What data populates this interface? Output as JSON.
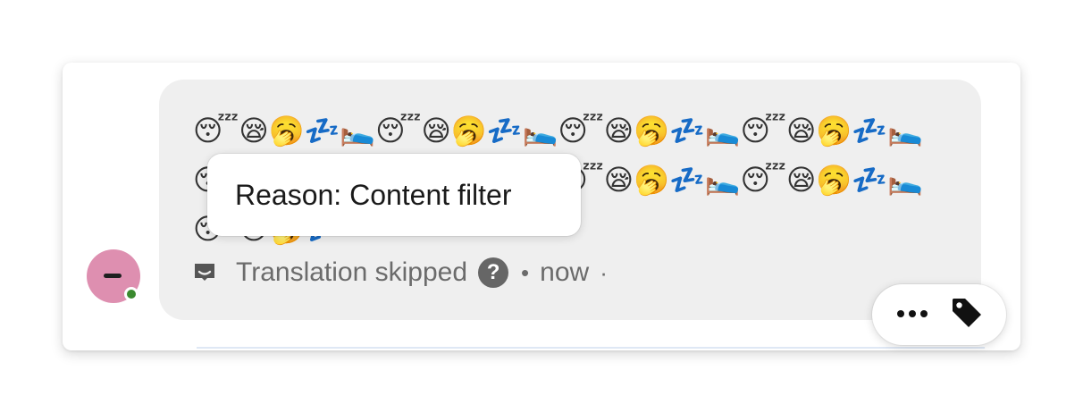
{
  "message": {
    "text": "😴😪🥱💤🛌😴😪🥱💤🛌😴😪🥱💤🛌😴😪🥱💤🛌😴😪🥱💤🛌😴😪🥱💤🛌😴😪🥱💤🛌😴😪🥱💤🛌😴😪🥱💤",
    "translation_status": "Translation skipped",
    "bullet": "•",
    "timestamp": "now",
    "trailing_dot": "·"
  },
  "tooltip": {
    "text": "Reason: Content filter"
  },
  "avatar": {
    "color": "#de8fb0",
    "presence_color": "#3a8a2f"
  },
  "icons": {
    "translation": "translate-icon",
    "help": "question-circle-icon",
    "more": "more-horizontal-icon",
    "tag": "tag-icon"
  },
  "colors": {
    "bubble": "#efefef",
    "meta_text": "#6b6b6b",
    "tooltip_bg": "#ffffff"
  }
}
